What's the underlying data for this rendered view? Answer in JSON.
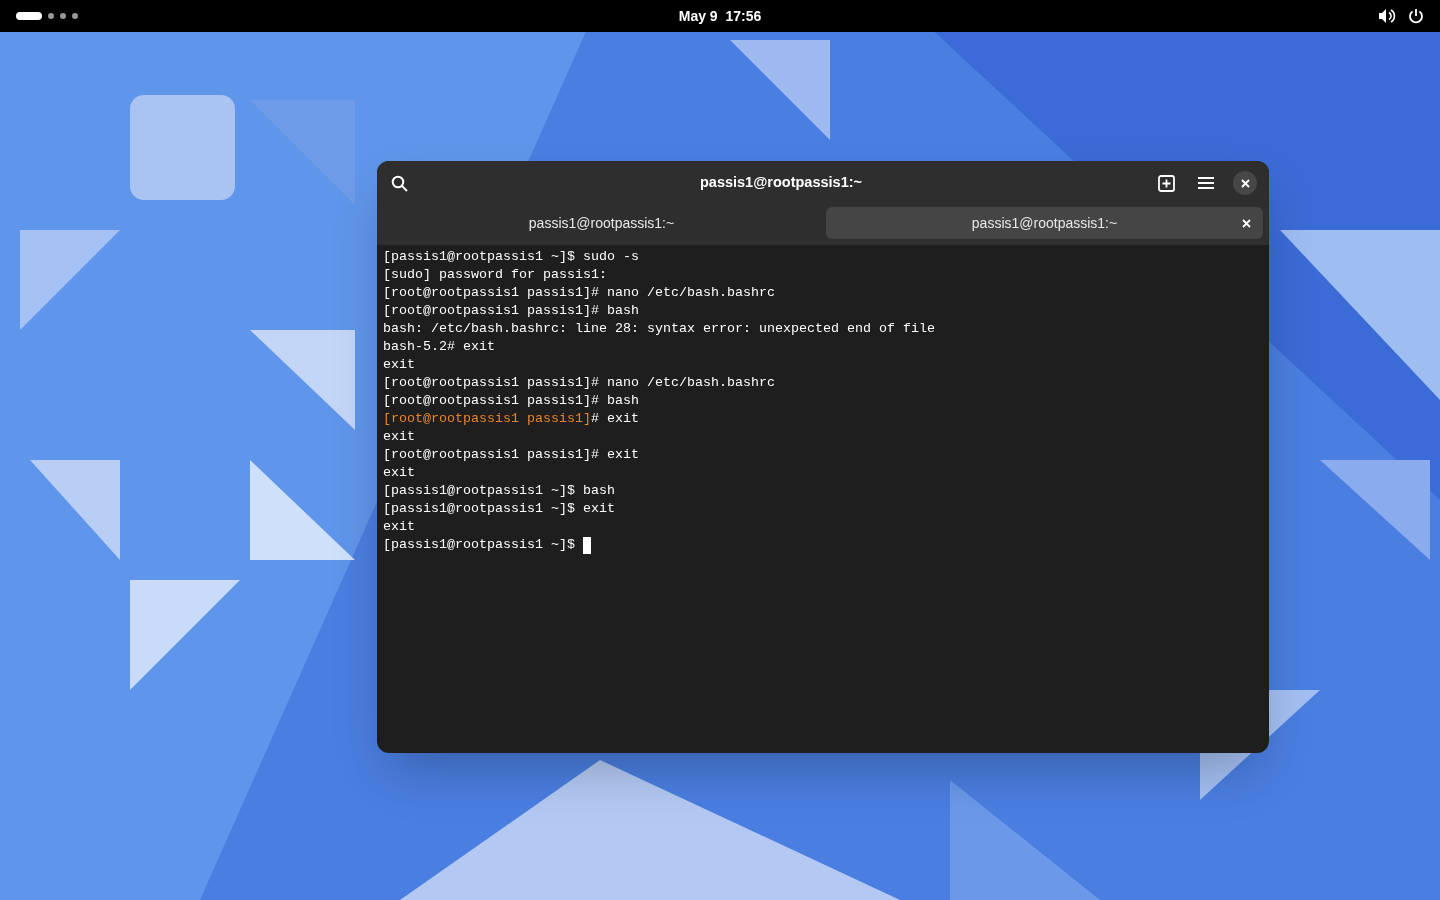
{
  "top_bar": {
    "workspaces": [
      {
        "selected": true
      },
      {
        "selected": false
      },
      {
        "selected": false
      },
      {
        "selected": false
      }
    ],
    "clock": "May 9  17:56"
  },
  "window": {
    "title": "passis1@rootpassis1:~",
    "tabs": [
      {
        "label": "passis1@rootpassis1:~",
        "selected": false
      },
      {
        "label": "passis1@rootpassis1:~",
        "selected": true
      }
    ],
    "terminal_lines": [
      [
        {
          "text": "[passis1@rootpassis1 ~]$ sudo -s",
          "kind": "plain"
        }
      ],
      [
        {
          "text": "[sudo] password for passis1:",
          "kind": "plain"
        }
      ],
      [
        {
          "text": "[root@rootpassis1 passis1]# nano /etc/bash.bashrc",
          "kind": "plain"
        }
      ],
      [
        {
          "text": "[root@rootpassis1 passis1]# bash",
          "kind": "plain"
        }
      ],
      [
        {
          "text": "bash: /etc/bash.bashrc: line 28: syntax error: unexpected end of file",
          "kind": "plain"
        }
      ],
      [
        {
          "text": "bash-5.2# exit",
          "kind": "plain"
        }
      ],
      [
        {
          "text": "exit",
          "kind": "plain"
        }
      ],
      [
        {
          "text": "[root@rootpassis1 passis1]# nano /etc/bash.bashrc",
          "kind": "plain"
        }
      ],
      [
        {
          "text": "[root@rootpassis1 passis1]# bash",
          "kind": "plain"
        }
      ],
      [
        {
          "text": "[root@rootpassis1 passis1]",
          "kind": "accent"
        },
        {
          "text": "# exit",
          "kind": "plain"
        }
      ],
      [
        {
          "text": "exit",
          "kind": "plain"
        }
      ],
      [
        {
          "text": "[root@rootpassis1 passis1]# exit",
          "kind": "plain"
        }
      ],
      [
        {
          "text": "exit",
          "kind": "plain"
        }
      ],
      [
        {
          "text": "[passis1@rootpassis1 ~]$ bash",
          "kind": "plain"
        }
      ],
      [
        {
          "text": "[passis1@rootpassis1 ~]$ exit",
          "kind": "plain"
        }
      ],
      [
        {
          "text": "exit",
          "kind": "plain"
        }
      ],
      [
        {
          "text": "[passis1@rootpassis1 ~]$",
          "kind": "plain"
        },
        {
          "kind": "cursor"
        }
      ]
    ]
  }
}
